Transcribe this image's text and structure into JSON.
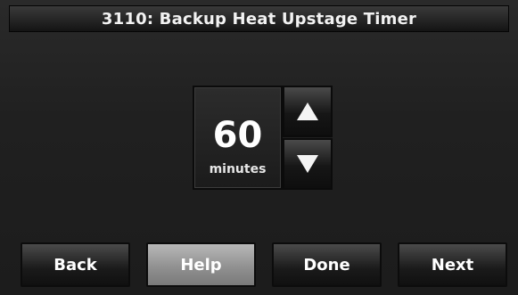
{
  "title": "3110: Backup Heat Upstage Timer",
  "setting": {
    "value": "60",
    "unit": "minutes",
    "increase_icon": "arrow-up-icon",
    "decrease_icon": "arrow-down-icon"
  },
  "softkeys": {
    "back": "Back",
    "help": "Help",
    "done": "Done",
    "next": "Next"
  }
}
